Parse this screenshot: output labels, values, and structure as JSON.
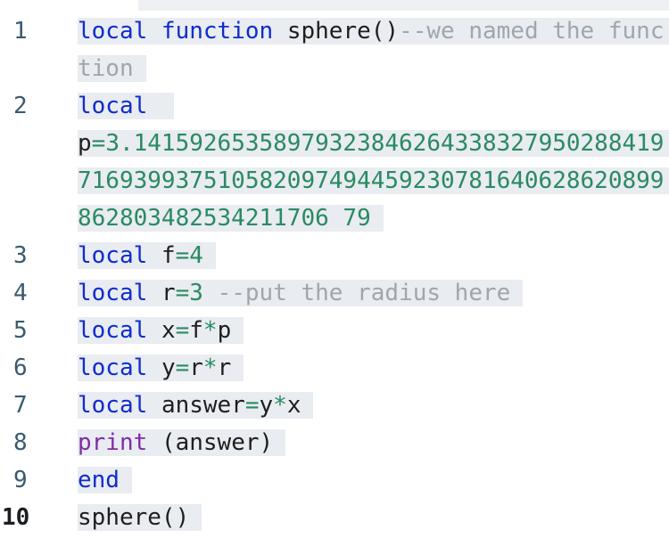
{
  "lines": [
    {
      "n": "1",
      "t": [
        {
          "c": "kw",
          "v": "local"
        },
        {
          "c": "sp",
          "v": " "
        },
        {
          "c": "kw",
          "v": "function"
        },
        {
          "c": "sp",
          "v": " "
        },
        {
          "c": "id",
          "v": "sphere()"
        },
        {
          "c": "cm",
          "v": "--we named the function"
        }
      ]
    },
    {
      "n": "2",
      "t": [
        {
          "c": "kw",
          "v": "local"
        },
        {
          "c": "sp",
          "v": " "
        },
        {
          "c": "id",
          "v": "p"
        },
        {
          "c": "op",
          "v": "="
        },
        {
          "c": "num",
          "v": "3.14159265358979323846264338327950288419716939937510582097494459230781640628620899862803482534211706 79"
        }
      ]
    },
    {
      "n": "3",
      "t": [
        {
          "c": "kw",
          "v": "local"
        },
        {
          "c": "sp",
          "v": " "
        },
        {
          "c": "id",
          "v": "f"
        },
        {
          "c": "op",
          "v": "="
        },
        {
          "c": "num",
          "v": "4"
        }
      ]
    },
    {
      "n": "4",
      "t": [
        {
          "c": "kw",
          "v": "local"
        },
        {
          "c": "sp",
          "v": " "
        },
        {
          "c": "id",
          "v": "r"
        },
        {
          "c": "op",
          "v": "="
        },
        {
          "c": "num",
          "v": "3"
        },
        {
          "c": "sp",
          "v": " "
        },
        {
          "c": "cm",
          "v": "--put the radius here"
        }
      ]
    },
    {
      "n": "5",
      "t": [
        {
          "c": "kw",
          "v": "local"
        },
        {
          "c": "sp",
          "v": " "
        },
        {
          "c": "id",
          "v": "x"
        },
        {
          "c": "op",
          "v": "="
        },
        {
          "c": "id",
          "v": "f"
        },
        {
          "c": "op",
          "v": "*"
        },
        {
          "c": "id",
          "v": "p"
        }
      ]
    },
    {
      "n": "6",
      "t": [
        {
          "c": "kw",
          "v": "local"
        },
        {
          "c": "sp",
          "v": " "
        },
        {
          "c": "id",
          "v": "y"
        },
        {
          "c": "op",
          "v": "="
        },
        {
          "c": "id",
          "v": "r"
        },
        {
          "c": "op",
          "v": "*"
        },
        {
          "c": "id",
          "v": "r"
        }
      ]
    },
    {
      "n": "7",
      "t": [
        {
          "c": "kw",
          "v": "local"
        },
        {
          "c": "sp",
          "v": " "
        },
        {
          "c": "id",
          "v": "answer"
        },
        {
          "c": "op",
          "v": "="
        },
        {
          "c": "id",
          "v": "y"
        },
        {
          "c": "op",
          "v": "*"
        },
        {
          "c": "id",
          "v": "x"
        }
      ]
    },
    {
      "n": "8",
      "t": [
        {
          "c": "fn",
          "v": "print"
        },
        {
          "c": "sp",
          "v": " "
        },
        {
          "c": "id",
          "v": "(answer)"
        }
      ]
    },
    {
      "n": "9",
      "t": [
        {
          "c": "kw",
          "v": "end"
        }
      ]
    },
    {
      "n": "10",
      "t": [
        {
          "c": "id",
          "v": "sphere()"
        }
      ],
      "current": true
    }
  ]
}
